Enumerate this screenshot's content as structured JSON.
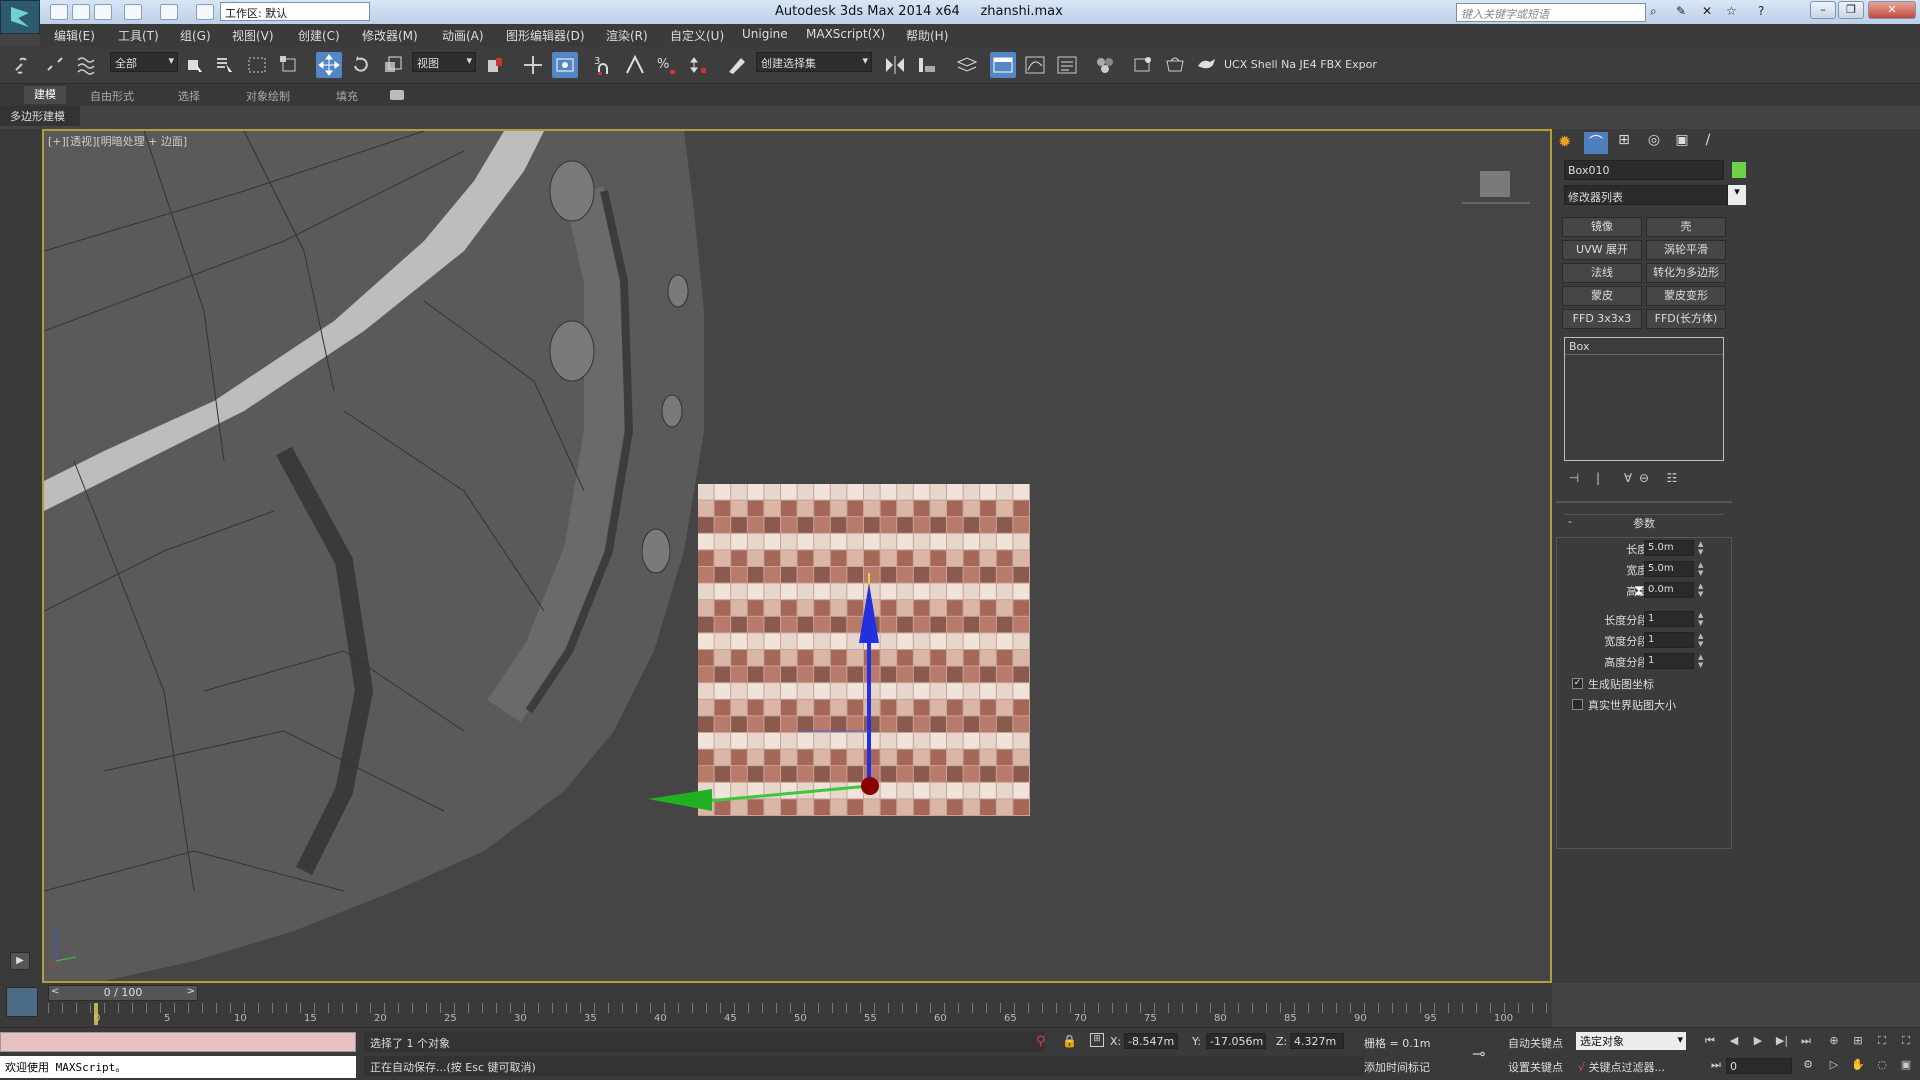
{
  "title": {
    "workspace": "工作区: 默认",
    "app": "Autodesk 3ds Max  2014 x64",
    "file": "zhanshi.max",
    "search_placeholder": "键入关键字或短语"
  },
  "menu": [
    "编辑(E)",
    "工具(T)",
    "组(G)",
    "视图(V)",
    "创建(C)",
    "修改器(M)",
    "动画(A)",
    "图形编辑器(D)",
    "渲染(R)",
    "自定义(U)",
    "Unigine",
    "MAXScript(X)",
    "帮助(H)"
  ],
  "toolbar": {
    "selection_filter": "全部",
    "ref_coord": "视图",
    "named_selection": "创建选择集",
    "plugin_label": "UCX Shell Na JE4 FBX Expor",
    "snap_label": "3"
  },
  "ribbon": {
    "tabs": [
      "建模",
      "自由形式",
      "选择",
      "对象绘制",
      "填充"
    ],
    "active_tab": "建模",
    "panel_label": "多边形建模"
  },
  "viewport": {
    "label": "[+][透视][明暗处理 + 边面]"
  },
  "command_panel": {
    "object_name": "Box010",
    "object_color": "#6cd24a",
    "modifier_list": "修改器列表",
    "modifier_buttons": [
      "镜像",
      "壳",
      "UVW 展开",
      "涡轮平滑",
      "法线",
      "转化为多边形",
      "蒙皮",
      "蒙皮变形",
      "FFD 3x3x3",
      "FFD(长方体)"
    ],
    "stack_items": [
      "Box"
    ],
    "params_title": "参数",
    "params": [
      {
        "label": "长度:",
        "value": "5.0m"
      },
      {
        "label": "宽度:",
        "value": "5.0m"
      },
      {
        "label": "高度:",
        "value": "0.0m"
      },
      {
        "label": "长度分段:",
        "value": "1"
      },
      {
        "label": "宽度分段:",
        "value": "1"
      },
      {
        "label": "高度分段:",
        "value": "1"
      }
    ],
    "checkboxes": [
      {
        "label": "生成贴图坐标",
        "checked": true
      },
      {
        "label": "真实世界贴图大小",
        "checked": false
      }
    ]
  },
  "timeline": {
    "slider_label": "0 / 100",
    "ticks": [
      "0",
      "5",
      "10",
      "15",
      "20",
      "25",
      "30",
      "35",
      "40",
      "45",
      "50",
      "55",
      "60",
      "65",
      "70",
      "75",
      "80",
      "85",
      "90",
      "95",
      "100"
    ]
  },
  "status": {
    "maxscript_hint": "欢迎使用 MAXScript。",
    "selection_msg": "选择了 1 个对象",
    "prompt_msg": "正在自动保存...(按 Esc 键可取消)",
    "x_label": "X:",
    "x": "-8.547m",
    "y_label": "Y:",
    "y": "-17.056m",
    "z_label": "Z:",
    "z": "4.327m",
    "grid": "栅格 = 0.1m",
    "add_time_tag": "添加时间标记",
    "auto_key": "自动关键点",
    "set_key": "设置关键点",
    "selected_object": "选定对象",
    "key_filters": "关键点过滤器...",
    "frame": "0"
  }
}
